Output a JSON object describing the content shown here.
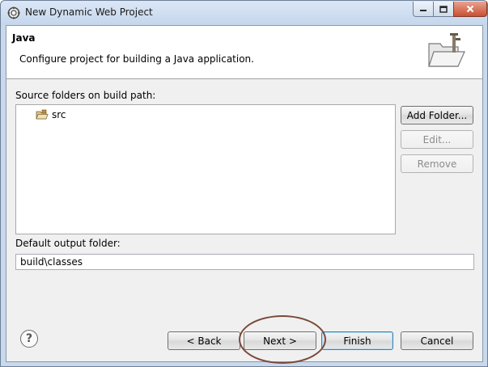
{
  "window": {
    "title": "New Dynamic Web Project",
    "controls": {
      "minimize": "minimize",
      "maximize": "maximize",
      "close": "close"
    }
  },
  "header": {
    "title": "Java",
    "description": "Configure project for building a Java application.",
    "image_icon": "folder-wizard-icon"
  },
  "source": {
    "label": "Source folders on build path:",
    "items": [
      {
        "label": "src",
        "icon": "package-folder-icon"
      }
    ]
  },
  "side_buttons": {
    "add_folder": "Add Folder...",
    "edit": "Edit...",
    "remove": "Remove"
  },
  "output": {
    "label": "Default output folder:",
    "value": "build\\classes"
  },
  "footer": {
    "back": "< Back",
    "next": "Next >",
    "finish": "Finish",
    "cancel": "Cancel",
    "help_icon": "help-icon"
  },
  "colors": {
    "frame": "#c9d9ec",
    "highlight_ring": "#7a4a3a",
    "close_button": "#c9502f"
  }
}
